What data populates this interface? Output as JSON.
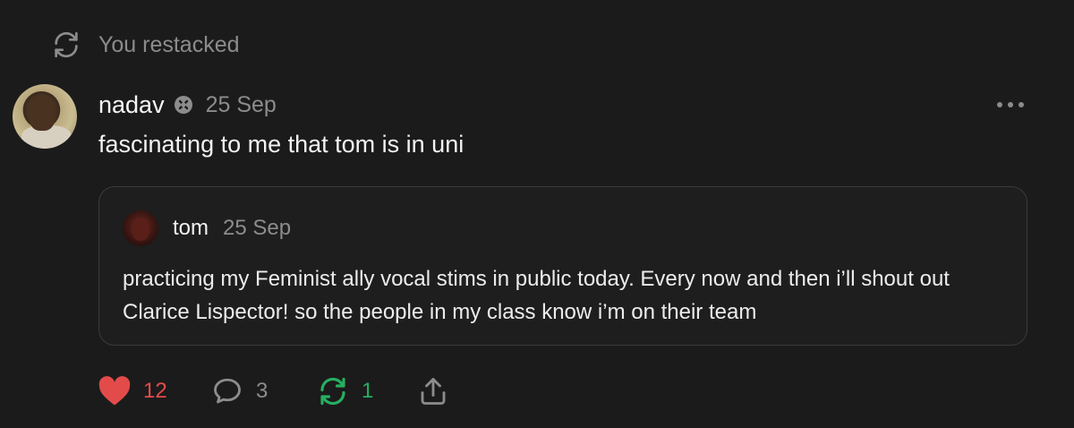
{
  "restack_notice": {
    "icon": "restack-icon",
    "text": "You restacked"
  },
  "post": {
    "author": "nadav",
    "badge_icon": "subscriber-badge-icon",
    "date": "25 Sep",
    "text": "fascinating to me that tom is in uni",
    "more_icon": "more-options-icon"
  },
  "quoted": {
    "author": "tom",
    "date": "25 Sep",
    "text": "practicing my Feminist ally vocal stims in public today. Every now and then i’ll shout out Clarice Lispector! so the people in my class know i’m on their team"
  },
  "actions": {
    "likes": "12",
    "comments": "3",
    "restacks": "1"
  },
  "colors": {
    "background": "#1b1b1b",
    "like": "#e34b4b",
    "restack": "#27ae60",
    "muted": "#8c8c8c"
  }
}
